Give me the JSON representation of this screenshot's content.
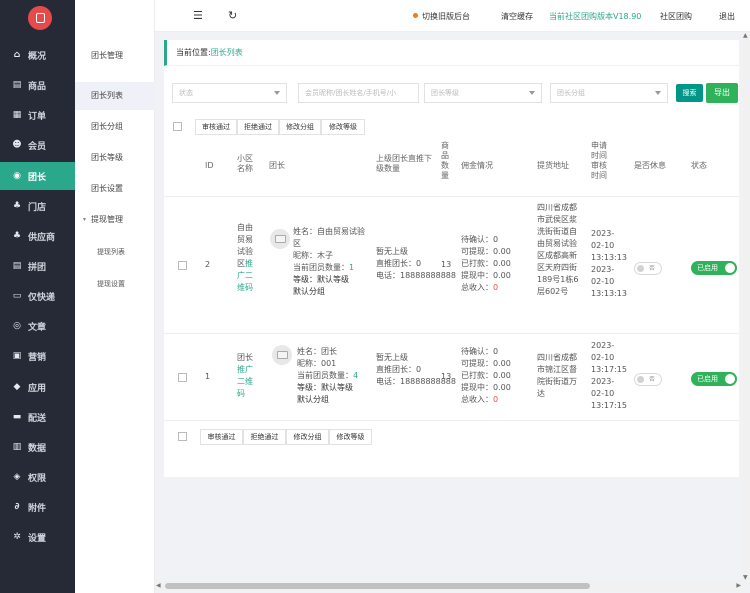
{
  "nav": [
    {
      "label": "概况",
      "icon": "home-icon",
      "glyph": "⌂"
    },
    {
      "label": "商品",
      "icon": "goods-icon",
      "glyph": "▤"
    },
    {
      "label": "订单",
      "icon": "order-icon",
      "glyph": "▦"
    },
    {
      "label": "会员",
      "icon": "member-icon",
      "glyph": "☻"
    },
    {
      "label": "团长",
      "icon": "leader-icon",
      "glyph": "◉"
    },
    {
      "label": "门店",
      "icon": "store-icon",
      "glyph": "♣"
    },
    {
      "label": "供应商",
      "icon": "supplier-icon",
      "glyph": "♣"
    },
    {
      "label": "拼团",
      "icon": "group-buy-icon",
      "glyph": "▤"
    },
    {
      "label": "仅快递",
      "icon": "express-icon",
      "glyph": "▭"
    },
    {
      "label": "文章",
      "icon": "article-icon",
      "glyph": "◎"
    },
    {
      "label": "营销",
      "icon": "marketing-icon",
      "glyph": "▣"
    },
    {
      "label": "应用",
      "icon": "app-icon",
      "glyph": "◆"
    },
    {
      "label": "配送",
      "icon": "delivery-icon",
      "glyph": "▬"
    },
    {
      "label": "数据",
      "icon": "data-icon",
      "glyph": "▥"
    },
    {
      "label": "权限",
      "icon": "permission-icon",
      "glyph": "◈"
    },
    {
      "label": "附件",
      "icon": "attachment-icon",
      "glyph": "∂"
    },
    {
      "label": "设置",
      "icon": "settings-icon",
      "glyph": "✲"
    }
  ],
  "submenu": {
    "items": [
      "团长管理",
      "团长列表",
      "团长分组",
      "团长等级",
      "团长设置"
    ],
    "group": "提现管理",
    "children": [
      "提现列表",
      "提现设置"
    ]
  },
  "topbar": {
    "switch": "切换旧版后台",
    "clear_cache": "清空缓存",
    "version": "当前社区团购版本V18.90",
    "community": "社区团购",
    "logout": "退出"
  },
  "breadcrumb": {
    "prefix": "当前位置:",
    "current": "团长列表"
  },
  "filters": {
    "status": "状态",
    "keyword": "会员昵称/团长姓名/手机号/小",
    "level": "团长等级",
    "group": "团长分组",
    "search": "搜索",
    "export": "导出"
  },
  "batch": [
    "审核通过",
    "拒绝通过",
    "修改分组",
    "修改等级"
  ],
  "columns": {
    "id": "ID",
    "community": "小区名称",
    "leader": "团长",
    "upper": "上级团长直推下级数量",
    "goods": "商品数量",
    "commission": "佣金情况",
    "address": "提货地址",
    "time": "申请时间审核时间",
    "rest": "是否休息",
    "status": "状态"
  },
  "rows": [
    {
      "id": "2",
      "community": "自由贸易试验区",
      "qr": "推广二维码",
      "name_line": "姓名：自由贸易试验区",
      "nick_line": "昵称：木子",
      "members_label": "当前团员数量：",
      "members": "1",
      "level_line": "等级：默认等级",
      "group_line": "默认分组",
      "upper_line": "暂无上级",
      "direct_line": "直推团长：0",
      "phone_line": "电话：18888888888",
      "goods": "13",
      "pending_label": "待确认：",
      "pending": "0",
      "withdrawable_label": "可提现：",
      "withdrawable": "0.00",
      "paid_label": "已打款：",
      "paid": "0.00",
      "withdrawing_label": "提现中：",
      "withdrawing": "0.00",
      "total_label": "总收入：",
      "total": "0",
      "address": "四川省成都市武侯区浆洗街街道自由贸易试验区成都高新区天府四街189号1栋6层602号",
      "apply_time": "2023-02-10 13:13:13",
      "audit_time": "2023-02-10 13:13:13",
      "rest": "否",
      "status": "已启用"
    },
    {
      "id": "1",
      "community": "团长",
      "qr": "推广二维码",
      "name_line": "姓名：团长",
      "nick_line": "昵称：001",
      "members_label": "当前团员数量：",
      "members": "4",
      "level_line": "等级：默认等级",
      "group_line": "默认分组",
      "upper_line": "暂无上级",
      "direct_line": "直推团长：0",
      "phone_line": "电话：18888888888",
      "goods": "13",
      "pending_label": "待确认：",
      "pending": "0",
      "withdrawable_label": "可提现：",
      "withdrawable": "0.00",
      "paid_label": "已打款：",
      "paid": "0.00",
      "withdrawing_label": "提现中：",
      "withdrawing": "0.00",
      "total_label": "总收入：",
      "total": "0",
      "address": "四川省成都市锦江区督院街街道万达",
      "apply_time": "2023-02-10 13:17:15",
      "audit_time": "2023-02-10 13:17:15",
      "rest": "否",
      "status": "已启用"
    }
  ],
  "colors": {
    "accent": "#2ba88b",
    "sidebar": "#262a36",
    "export": "#2fb25a",
    "danger": "#e64b4b"
  }
}
